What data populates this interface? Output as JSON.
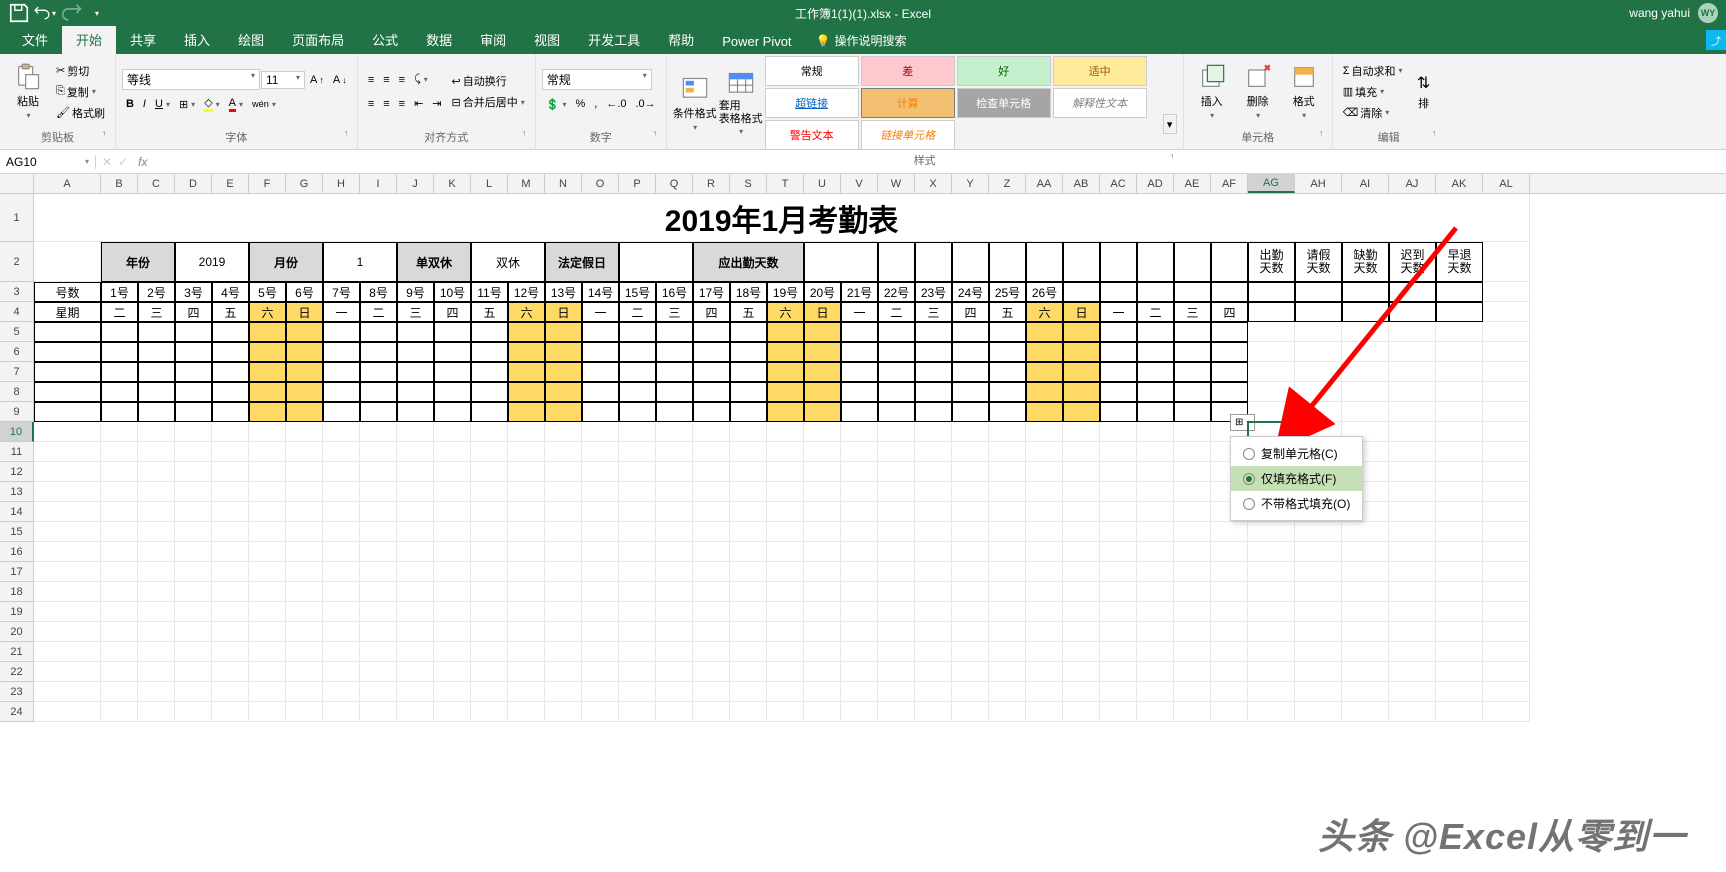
{
  "app_title": "工作簿1(1)(1).xlsx - Excel",
  "user_name": "wang yahui",
  "user_initials": "WY",
  "tabs": [
    "文件",
    "开始",
    "共享",
    "插入",
    "绘图",
    "页面布局",
    "公式",
    "数据",
    "审阅",
    "视图",
    "开发工具",
    "帮助",
    "Power Pivot"
  ],
  "active_tab": "开始",
  "tell_me": "操作说明搜索",
  "clipboard": {
    "paste": "粘贴",
    "cut": "剪切",
    "copy": "复制",
    "fmt": "格式刷",
    "label": "剪贴板"
  },
  "font": {
    "name": "等线",
    "size": "11",
    "label": "字体"
  },
  "align": {
    "wrap": "自动换行",
    "merge": "合并后居中",
    "label": "对齐方式"
  },
  "number": {
    "fmt": "常规",
    "label": "数字"
  },
  "styles": {
    "cond": "条件格式",
    "table": "套用\n表格格式",
    "normal": "常规",
    "bad": "差",
    "good": "好",
    "neutral": "适中",
    "link": "超链接",
    "calc": "计算",
    "check": "检查单元格",
    "explain": "解释性文本",
    "warn": "警告文本",
    "linkcell": "链接单元格",
    "label": "样式"
  },
  "cells": {
    "insert": "插入",
    "delete": "删除",
    "format": "格式",
    "label": "单元格"
  },
  "edit": {
    "sum": "自动求和",
    "fill": "填充",
    "clear": "清除",
    "sort": "排",
    "label": "编辑"
  },
  "name_box": "AG10",
  "sheet": {
    "title": "2019年1月考勤表",
    "headers1": {
      "year": "年份",
      "year_v": "2019",
      "month": "月份",
      "month_v": "1",
      "rest": "单双休",
      "rest_v": "双休",
      "holiday": "法定假日",
      "due": "应出勤天数"
    },
    "stats": [
      "出勤\n天数",
      "请假\n天数",
      "缺勤\n天数",
      "迟到\n天数",
      "早退\n天数"
    ],
    "row3": [
      "号数",
      "1号",
      "2号",
      "3号",
      "4号",
      "5号",
      "6号",
      "7号",
      "8号",
      "9号",
      "10号",
      "11号",
      "12号",
      "13号",
      "14号",
      "15号",
      "16号",
      "17号",
      "18号",
      "19号",
      "20号",
      "21号",
      "22号",
      "23号",
      "24号",
      "25号",
      "26号"
    ],
    "row4": [
      "星期",
      "二",
      "三",
      "四",
      "五",
      "六",
      "日",
      "一",
      "二",
      "三",
      "四",
      "五",
      "六",
      "日",
      "一",
      "二",
      "三",
      "四",
      "五",
      "六",
      "日",
      "一",
      "二",
      "三",
      "四",
      "五",
      "六",
      "日",
      "一",
      "二",
      "三",
      "四"
    ]
  },
  "fill_menu": {
    "btn": "⊞",
    "items": [
      "复制单元格(C)",
      "仅填充格式(F)",
      "不带格式填充(O)"
    ],
    "active": 1
  },
  "watermark": "头条 @Excel从零到一",
  "columns": [
    "A",
    "B",
    "C",
    "D",
    "E",
    "F",
    "G",
    "H",
    "I",
    "J",
    "K",
    "L",
    "M",
    "N",
    "O",
    "P",
    "Q",
    "R",
    "S",
    "T",
    "U",
    "V",
    "W",
    "X",
    "Y",
    "Z",
    "AA",
    "AB",
    "AC",
    "AD",
    "AE",
    "AF",
    "AG",
    "AH",
    "AI",
    "AJ",
    "AK",
    "AL"
  ],
  "selected_cell": "AG10"
}
